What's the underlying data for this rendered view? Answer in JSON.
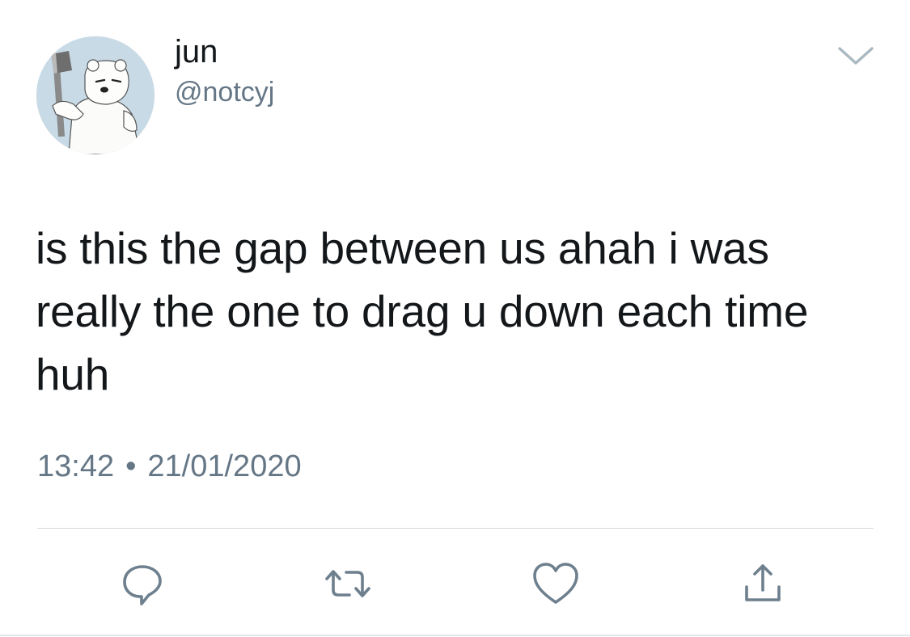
{
  "user": {
    "display_name": "jun",
    "handle": "@notcyj"
  },
  "tweet": {
    "text": "is this the gap between us ahah i was really the one to drag u down each time huh",
    "time": "13:42",
    "separator": "•",
    "date": "21/01/2020"
  },
  "icons": {
    "menu": "chevron-down-icon",
    "reply": "reply-icon",
    "retweet": "retweet-icon",
    "like": "heart-icon",
    "share": "share-icon"
  },
  "colors": {
    "text": "#14171a",
    "secondary": "#657786",
    "divider": "#d4d9de"
  }
}
